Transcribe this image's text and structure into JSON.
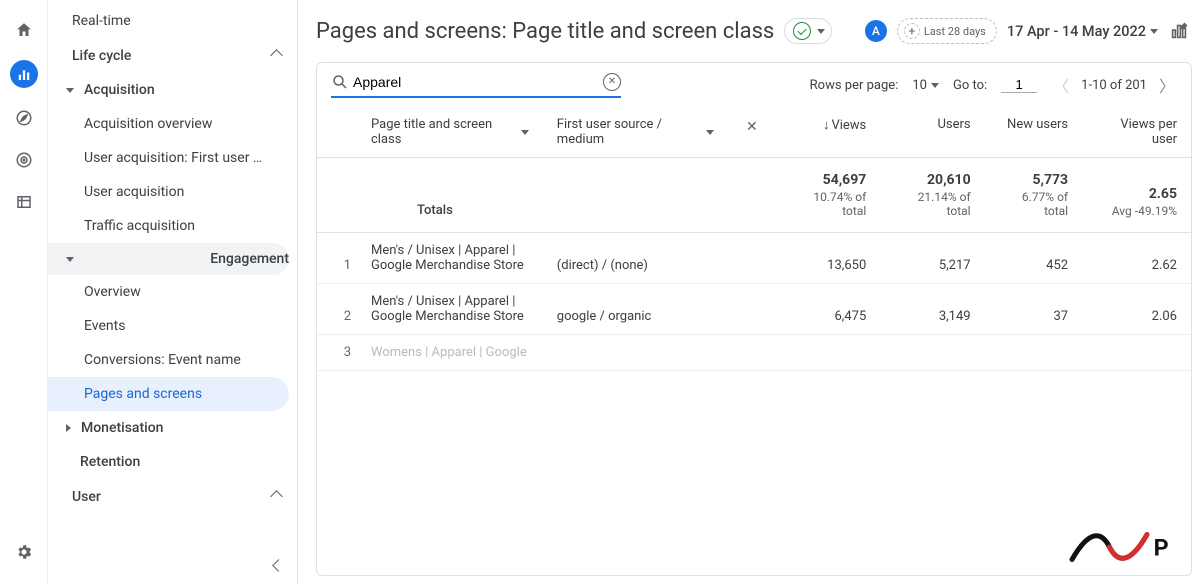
{
  "sidebar": {
    "realtime": "Real-time",
    "lifecycle": "Life cycle",
    "acquisition": "Acquisition",
    "acq_items": [
      "Acquisition overview",
      "User acquisition: First user …",
      "User acquisition",
      "Traffic acquisition"
    ],
    "engagement": "Engagement",
    "eng_items": [
      "Overview",
      "Events",
      "Conversions: Event name",
      "Pages and screens"
    ],
    "monetisation": "Monetisation",
    "retention": "Retention",
    "user": "User"
  },
  "header": {
    "title": "Pages and screens: Page title and screen class",
    "avatar_letter": "A",
    "compare_label": "Last 28 days",
    "date_range": "17 Apr - 14 May 2022"
  },
  "toolbar": {
    "search_value": "Apparel",
    "rows_label": "Rows per page:",
    "rows_value": "10",
    "goto_label": "Go to:",
    "goto_value": "1",
    "range_label": "1-10 of 201"
  },
  "columns": {
    "dim_primary": "Page title and screen class",
    "dim_secondary": "First user source / medium",
    "views": "Views",
    "users": "Users",
    "new_users": "New users",
    "vpu": "Views per user"
  },
  "totals": {
    "label": "Totals",
    "views": "54,697",
    "views_sub": "10.74% of total",
    "users": "20,610",
    "users_sub": "21.14% of total",
    "new_users": "5,773",
    "new_users_sub": "6.77% of total",
    "vpu": "2.65",
    "vpu_sub": "Avg -49.19%"
  },
  "rows": [
    {
      "idx": "1",
      "page": "Men's / Unisex | Apparel | Google Merchandise Store",
      "src": "(direct) / (none)",
      "views": "13,650",
      "users": "5,217",
      "new_users": "452",
      "vpu": "2.62"
    },
    {
      "idx": "2",
      "page": "Men's / Unisex | Apparel | Google Merchandise Store",
      "src": "google / organic",
      "views": "6,475",
      "users": "3,149",
      "new_users": "37",
      "vpu": "2.06"
    },
    {
      "idx": "3",
      "page": "Womens | Apparel | Google",
      "src": "",
      "views": "",
      "users": "",
      "new_users": "",
      "vpu": ""
    }
  ]
}
